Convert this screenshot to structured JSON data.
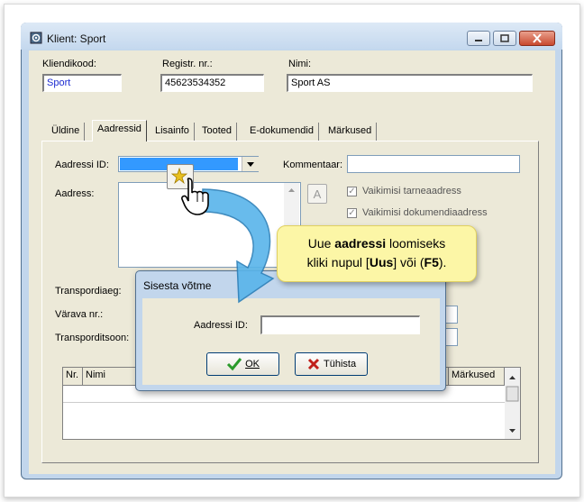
{
  "window": {
    "title": "Klient: Sport"
  },
  "header": {
    "kliendikood": {
      "label": "Kliendikood:",
      "value": "Sport"
    },
    "registr": {
      "label": "Registr. nr.:",
      "value": "45623534352"
    },
    "nimi": {
      "label": "Nimi:",
      "value": "Sport AS"
    }
  },
  "tabs": [
    {
      "label": "Üldine"
    },
    {
      "label": "Aadressid"
    },
    {
      "label": "Lisainfo"
    },
    {
      "label": "Tooted"
    },
    {
      "label": "E-dokumendid"
    },
    {
      "label": "Märkused"
    }
  ],
  "active_tab": "Aadressid",
  "form": {
    "aadressi_id_label": "Aadressi ID:",
    "kommentaar_label": "Kommentaar:",
    "aadress_label": "Aadress:",
    "a_button": "A",
    "vaikimisi_tarne": "Vaikimisi tarneaadress",
    "vaikimisi_dokumendi": "Vaikimisi dokumendiaadress",
    "transpordiaeg_label": "Transpordiaeg:",
    "varava_label": "Värava nr.:",
    "transporditsoon_label": "Transporditsoon:"
  },
  "grid": {
    "columns": [
      "Nr.",
      "Nimi",
      "Märkused"
    ]
  },
  "dialog": {
    "title": "Sisesta võtme",
    "field_label": "Aadressi ID:",
    "field_value": "",
    "ok_label": "OK",
    "cancel_label": "Tühista"
  },
  "tooltip": {
    "line1_pre": "Uue ",
    "line1_bold": "aadressi",
    "line1_post": " loomiseks",
    "line2_pre": "kliki nupul [",
    "line2_bold": "Uus",
    "line2_mid": "] või (",
    "line2_bold2": "F5",
    "line2_post": ")."
  },
  "colors": {
    "window_frame": "#c2d6ec",
    "face": "#ece9d8",
    "selection": "#3399ff",
    "tooltip_bg": "#fcf6a6",
    "arrow": "#4aa8e0"
  }
}
